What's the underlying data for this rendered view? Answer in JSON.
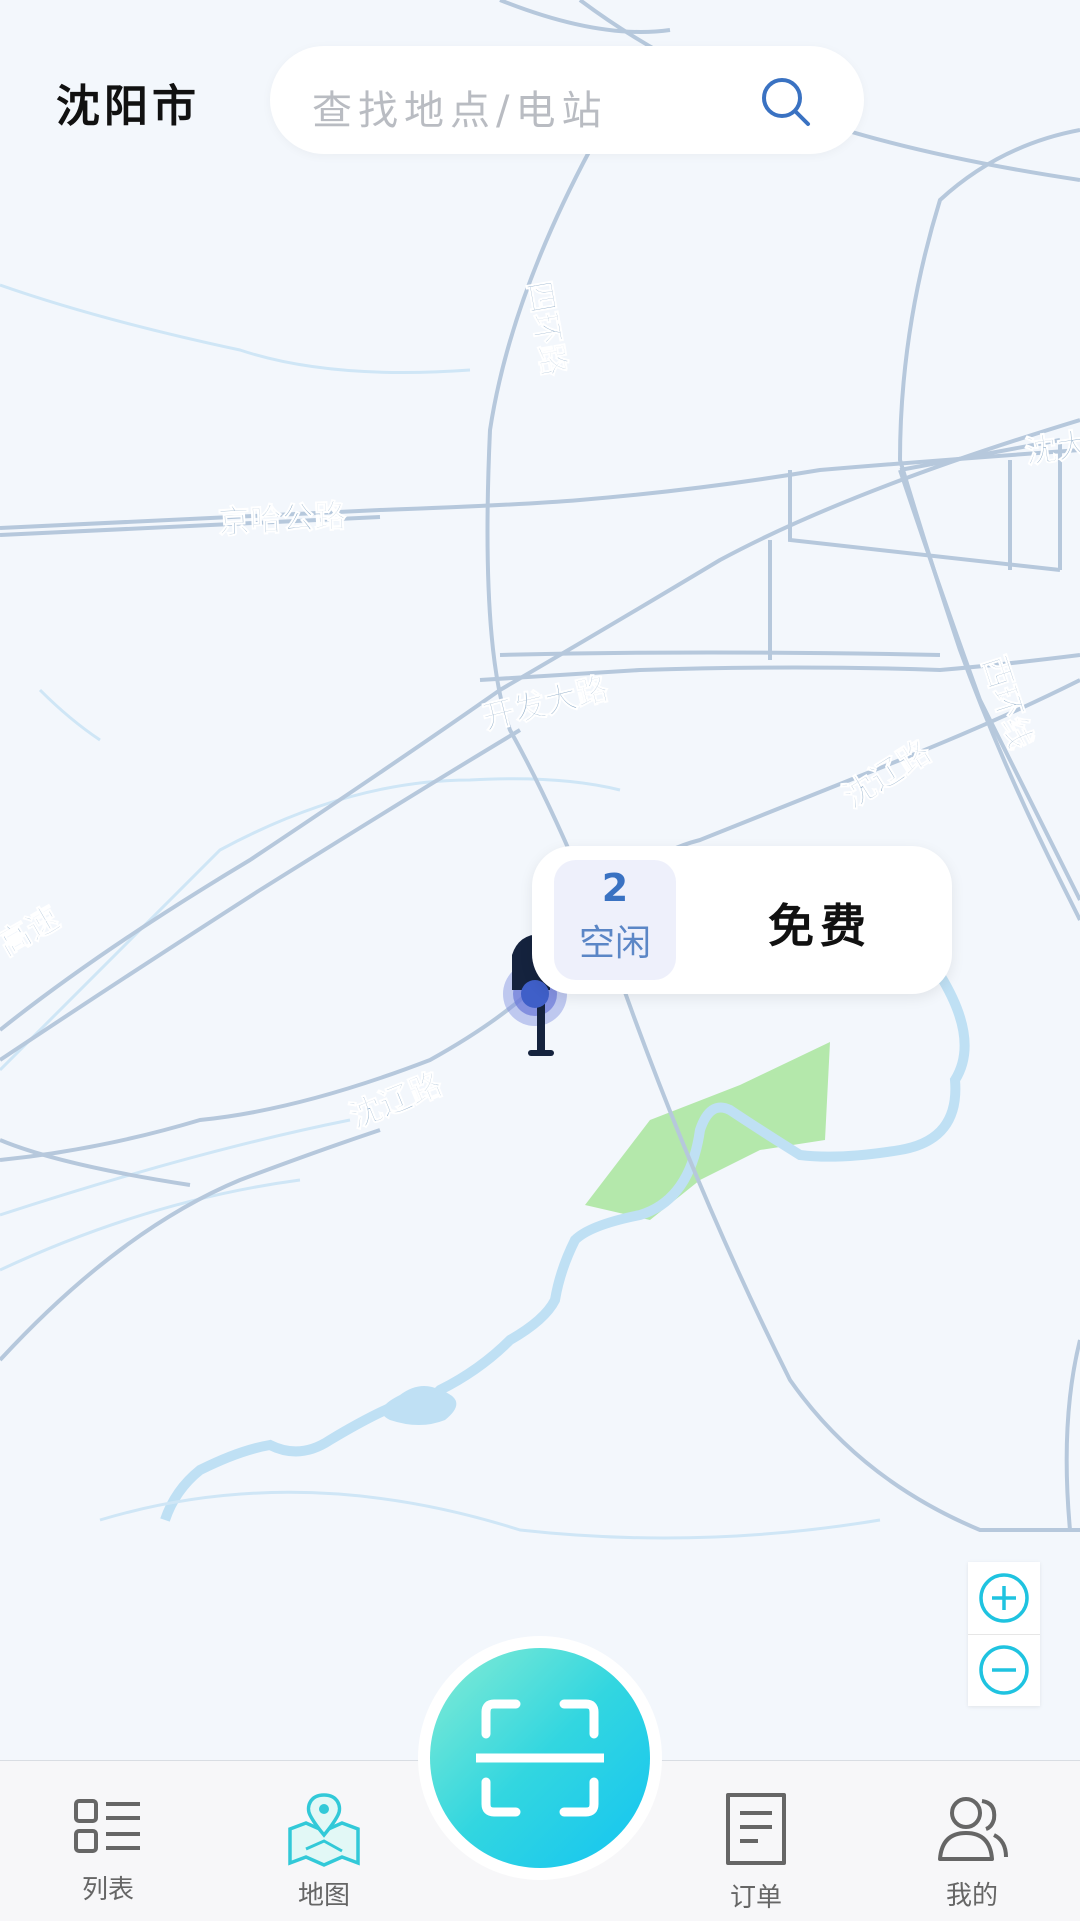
{
  "header": {
    "city": "沈阳市",
    "search_placeholder": "查找地点/电站",
    "search_icon": "search-icon"
  },
  "map": {
    "road_labels": [
      "四环路",
      "京哈公路",
      "开发大路",
      "沈辽路",
      "沈辽路",
      "西环线",
      "沈大",
      "高速"
    ],
    "water_color": "#bfe0f4",
    "park_color": "#b4e8ab",
    "road_color": "#b6c8dc"
  },
  "station_popup": {
    "count": "2",
    "status": "空闲",
    "price": "免费"
  },
  "zoom": {
    "in_icon": "zoom-in-icon",
    "out_icon": "zoom-out-icon"
  },
  "scan_button": {
    "icon": "scan-icon",
    "gradient": [
      "#86ecd3",
      "#14c4f2"
    ]
  },
  "bottom_nav": {
    "items": [
      {
        "label": "列表",
        "icon": "list-icon"
      },
      {
        "label": "地图",
        "icon": "map-icon",
        "active": true
      },
      {
        "label": "订单",
        "icon": "order-icon"
      },
      {
        "label": "我的",
        "icon": "profile-icon"
      }
    ],
    "active_color": "#32c9d8",
    "inactive_color": "#666666"
  }
}
